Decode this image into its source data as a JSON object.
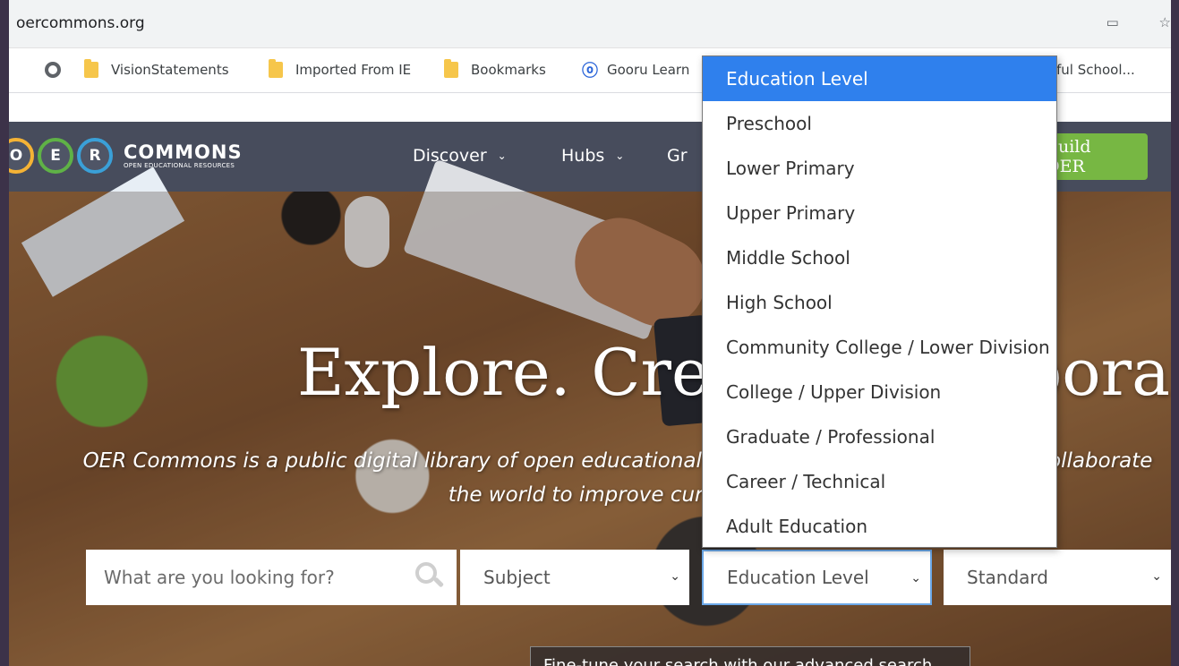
{
  "browser": {
    "url": "oercommons.org",
    "bookmarks": [
      {
        "icon": "globe-icon",
        "label": ""
      },
      {
        "icon": "folder-icon",
        "label": "VisionStatements"
      },
      {
        "icon": "folder-icon",
        "label": "Imported From IE"
      },
      {
        "icon": "folder-icon",
        "label": "Bookmarks"
      },
      {
        "icon": "gooru-icon",
        "label": "Gooru Learn"
      },
      {
        "icon": "",
        "label": "ful School..."
      }
    ]
  },
  "site": {
    "logo_letters": [
      "O",
      "E",
      "R"
    ],
    "logo_title": "COMMONS",
    "logo_subtitle": "OPEN EDUCATIONAL RESOURCES",
    "nav": [
      "Discover",
      "Hubs",
      "Gr"
    ],
    "build_button": "Build OER"
  },
  "hero": {
    "title": "Explore. Create. Collaborate.",
    "subtitle_line1": "OER Commons is a public digital library of open educational resources. Explore, create, and collaborate",
    "subtitle_line2": "the world to improve curriculum."
  },
  "search": {
    "placeholder": "What are you looking for?",
    "subject": "Subject",
    "education_level": "Education Level",
    "standard": "Standard",
    "advanced_text": "Fine-tune your search with our advanced search"
  },
  "dropdown": {
    "options": [
      "Education Level",
      "Preschool",
      "Lower Primary",
      "Upper Primary",
      "Middle School",
      "High School",
      "Community College / Lower Division",
      "College / Upper Division",
      "Graduate / Professional",
      "Career / Technical",
      "Adult Education"
    ],
    "selected_index": 0
  },
  "colors": {
    "nav_bg": "#474c5c",
    "build_button": "#77b743",
    "selected_option": "#2f80ed",
    "frame": "#3c3249"
  }
}
